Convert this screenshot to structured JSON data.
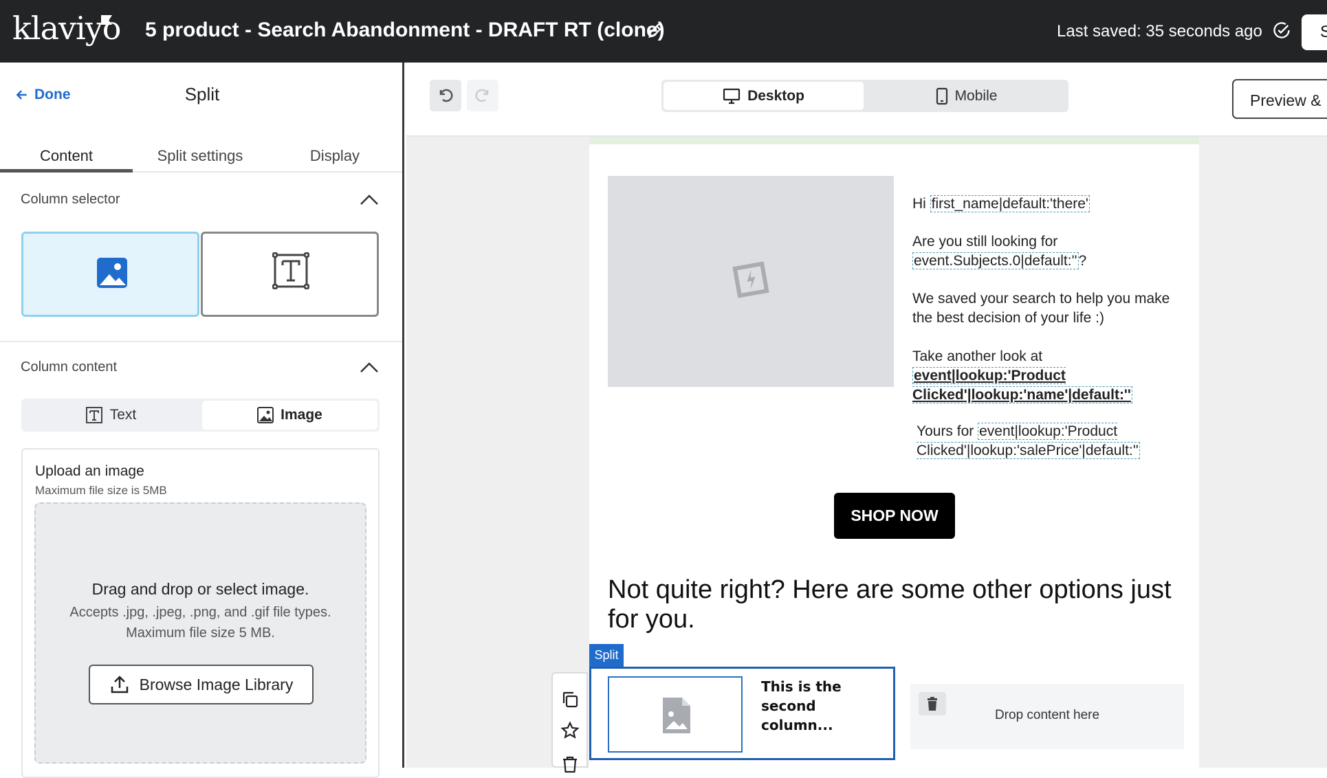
{
  "header": {
    "logo": "klaviyo",
    "title": "5 product - Search Abandonment - DRAFT RT (clone)",
    "saved_status": "Last saved: 35 seconds ago",
    "partial_button": "S"
  },
  "left_panel": {
    "done_label": "Done",
    "title": "Split",
    "tabs": [
      {
        "label": "Content",
        "active": true
      },
      {
        "label": "Split settings",
        "active": false
      },
      {
        "label": "Display",
        "active": false
      }
    ],
    "column_selector": {
      "heading": "Column selector",
      "selected": "image"
    },
    "column_content": {
      "heading": "Column content",
      "text_option": "Text",
      "image_option": "Image",
      "selected": "Image"
    },
    "upload": {
      "title": "Upload an image",
      "max_size": "Maximum file size is 5MB",
      "drop_title": "Drag and drop or select image.",
      "drop_types": "Accepts .jpg, .jpeg, .png, and .gif file types.",
      "drop_max": "Maximum file size 5 MB.",
      "browse_label": "Browse Image Library"
    }
  },
  "toolbar": {
    "desktop_label": "Desktop",
    "mobile_label": "Mobile",
    "active_device": "Desktop",
    "preview_label": "Preview &"
  },
  "email": {
    "greeting_prefix": "Hi ",
    "greeting_token": "first_name|default:'there'",
    "line2_prefix": "Are you still looking for",
    "line2_token": "event.Subjects.0|default:''",
    "line2_suffix": "?",
    "line3": "We saved your search to help you make the best decision of your life :)",
    "line4_prefix": "Take another look at",
    "line4_token": "event|lookup:'Product Clicked'|lookup:'name'|default:''",
    "line5_prefix": "Yours for ",
    "line5_token": "event|lookup:'Product Clicked'|lookup:'salePrice'|default:''",
    "shop_button": "SHOP NOW",
    "heading": "Not quite right? Here are some other options just for you.",
    "split_tag": "Split",
    "split_column_text": "This is the second column...",
    "drop_content": "Drop content here"
  },
  "colors": {
    "topbar": "#232426",
    "accent_blue": "#1f6ccc",
    "selected_column_bg": "#e3f4fd",
    "canvas_bg": "#efefef"
  }
}
